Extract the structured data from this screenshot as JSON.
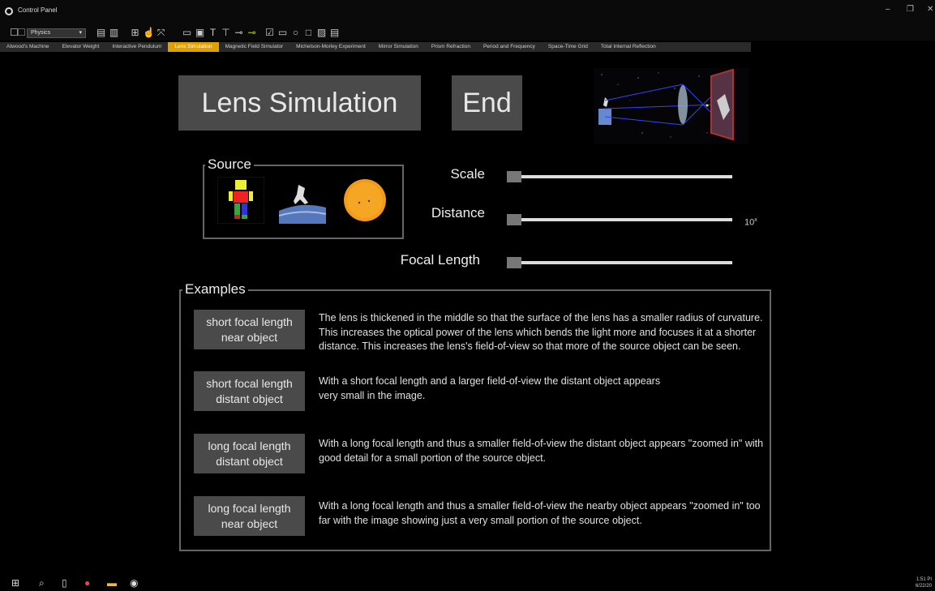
{
  "window": {
    "title": "Control Panel",
    "minimize": "–",
    "restore": "❐",
    "close": "✕"
  },
  "toolbar": {
    "category_select": "Physics"
  },
  "tabs": [
    {
      "label": "Atwood's Machine",
      "active": false
    },
    {
      "label": "Elevator Weight",
      "active": false
    },
    {
      "label": "Interactive Pendulum",
      "active": false
    },
    {
      "label": "Lens Simulation",
      "active": true
    },
    {
      "label": "Magnetic Field Simulator",
      "active": false
    },
    {
      "label": "Michelson-Morley Experiment",
      "active": false
    },
    {
      "label": "Mirror Simulation",
      "active": false
    },
    {
      "label": "Prism Refraction",
      "active": false
    },
    {
      "label": "Period and Frequency",
      "active": false
    },
    {
      "label": "Space-Time Grid",
      "active": false
    },
    {
      "label": "Total Internal Reflection",
      "active": false
    }
  ],
  "main": {
    "title_button": "Lens Simulation",
    "end_button": "End"
  },
  "source": {
    "label": "Source"
  },
  "sliders": {
    "scale": {
      "label": "Scale",
      "value": 0.0
    },
    "distance": {
      "label": "Distance",
      "value": 0.0,
      "exponent_base": "10",
      "exponent_sup": "x"
    },
    "focal_length": {
      "label": "Focal Length",
      "value": 0.0
    }
  },
  "examples": {
    "label": "Examples",
    "items": [
      {
        "button": "short focal length\nnear object",
        "text": "The lens is thickened in the middle so that the surface of the lens has a smaller radius of curvature. This increases the optical power of the lens which bends the light more and focuses it at a shorter distance. This increases the lens's field-of-view so that more of the source object can be seen."
      },
      {
        "button": "short focal length\ndistant object",
        "text": "With a short focal length and a larger field-of-view the distant object appears very small in the image."
      },
      {
        "button": "long focal length\ndistant object",
        "text": "With a long focal length and thus a smaller field-of-view the distant object appears \"zoomed in\" with good detail for a small portion of the source object."
      },
      {
        "button": "long focal length\nnear object",
        "text": "With a long focal length and thus a smaller field-of-view the nearby object appears \"zoomed in\" too far with the image showing just a very small portion of the source object."
      }
    ]
  },
  "taskbar": {
    "time": "1:51 PI",
    "date": "6/22/20"
  },
  "colors": {
    "accent_tab": "#e0a000",
    "button_bg": "#4a4a4a",
    "background": "#000000"
  }
}
